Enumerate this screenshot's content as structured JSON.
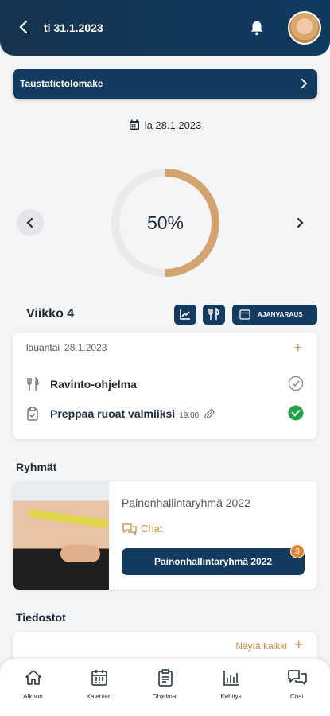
{
  "header": {
    "date": "ti 31.1.2023",
    "back_icon": "chevron-left-icon",
    "bell_icon": "bell-icon"
  },
  "banner": {
    "label": "Taustatietolomake"
  },
  "selected_date": "la 28.1.2023",
  "progress": {
    "percent_label": "50%",
    "value": 0.5,
    "color": "#d4a46f",
    "track_color": "#e9eaec"
  },
  "week": {
    "label": "Viikko 4",
    "booking_label": "AJANVARAUS"
  },
  "day_card": {
    "weekday": "lauantai",
    "date": "28.1.2023",
    "tasks": [
      {
        "name": "Ravinto-ohjelma",
        "time": "",
        "done": false
      },
      {
        "name": "Preppaa ruoat valmiiksi",
        "time": "19:00",
        "done": true
      }
    ]
  },
  "groups": {
    "title": "Ryhmät",
    "name": "Painonhallintaryhmä 2022",
    "chat_label": "Chat",
    "button_label": "Painonhallintaryhmä 2022",
    "badge": "3"
  },
  "files": {
    "title": "Tiedostot",
    "show_all": "Näytä kaikki"
  },
  "tabs": [
    {
      "label": "Alkuun",
      "icon": "home-icon"
    },
    {
      "label": "Kalenteri",
      "icon": "calendar-icon"
    },
    {
      "label": "Ohjelmat",
      "icon": "clipboard-icon"
    },
    {
      "label": "Kehitys",
      "icon": "bar-chart-icon"
    },
    {
      "label": "Chat",
      "icon": "chat-icon"
    }
  ],
  "colors": {
    "primary": "#133b60",
    "accent": "#d08a3c",
    "success": "#1fa34a"
  }
}
